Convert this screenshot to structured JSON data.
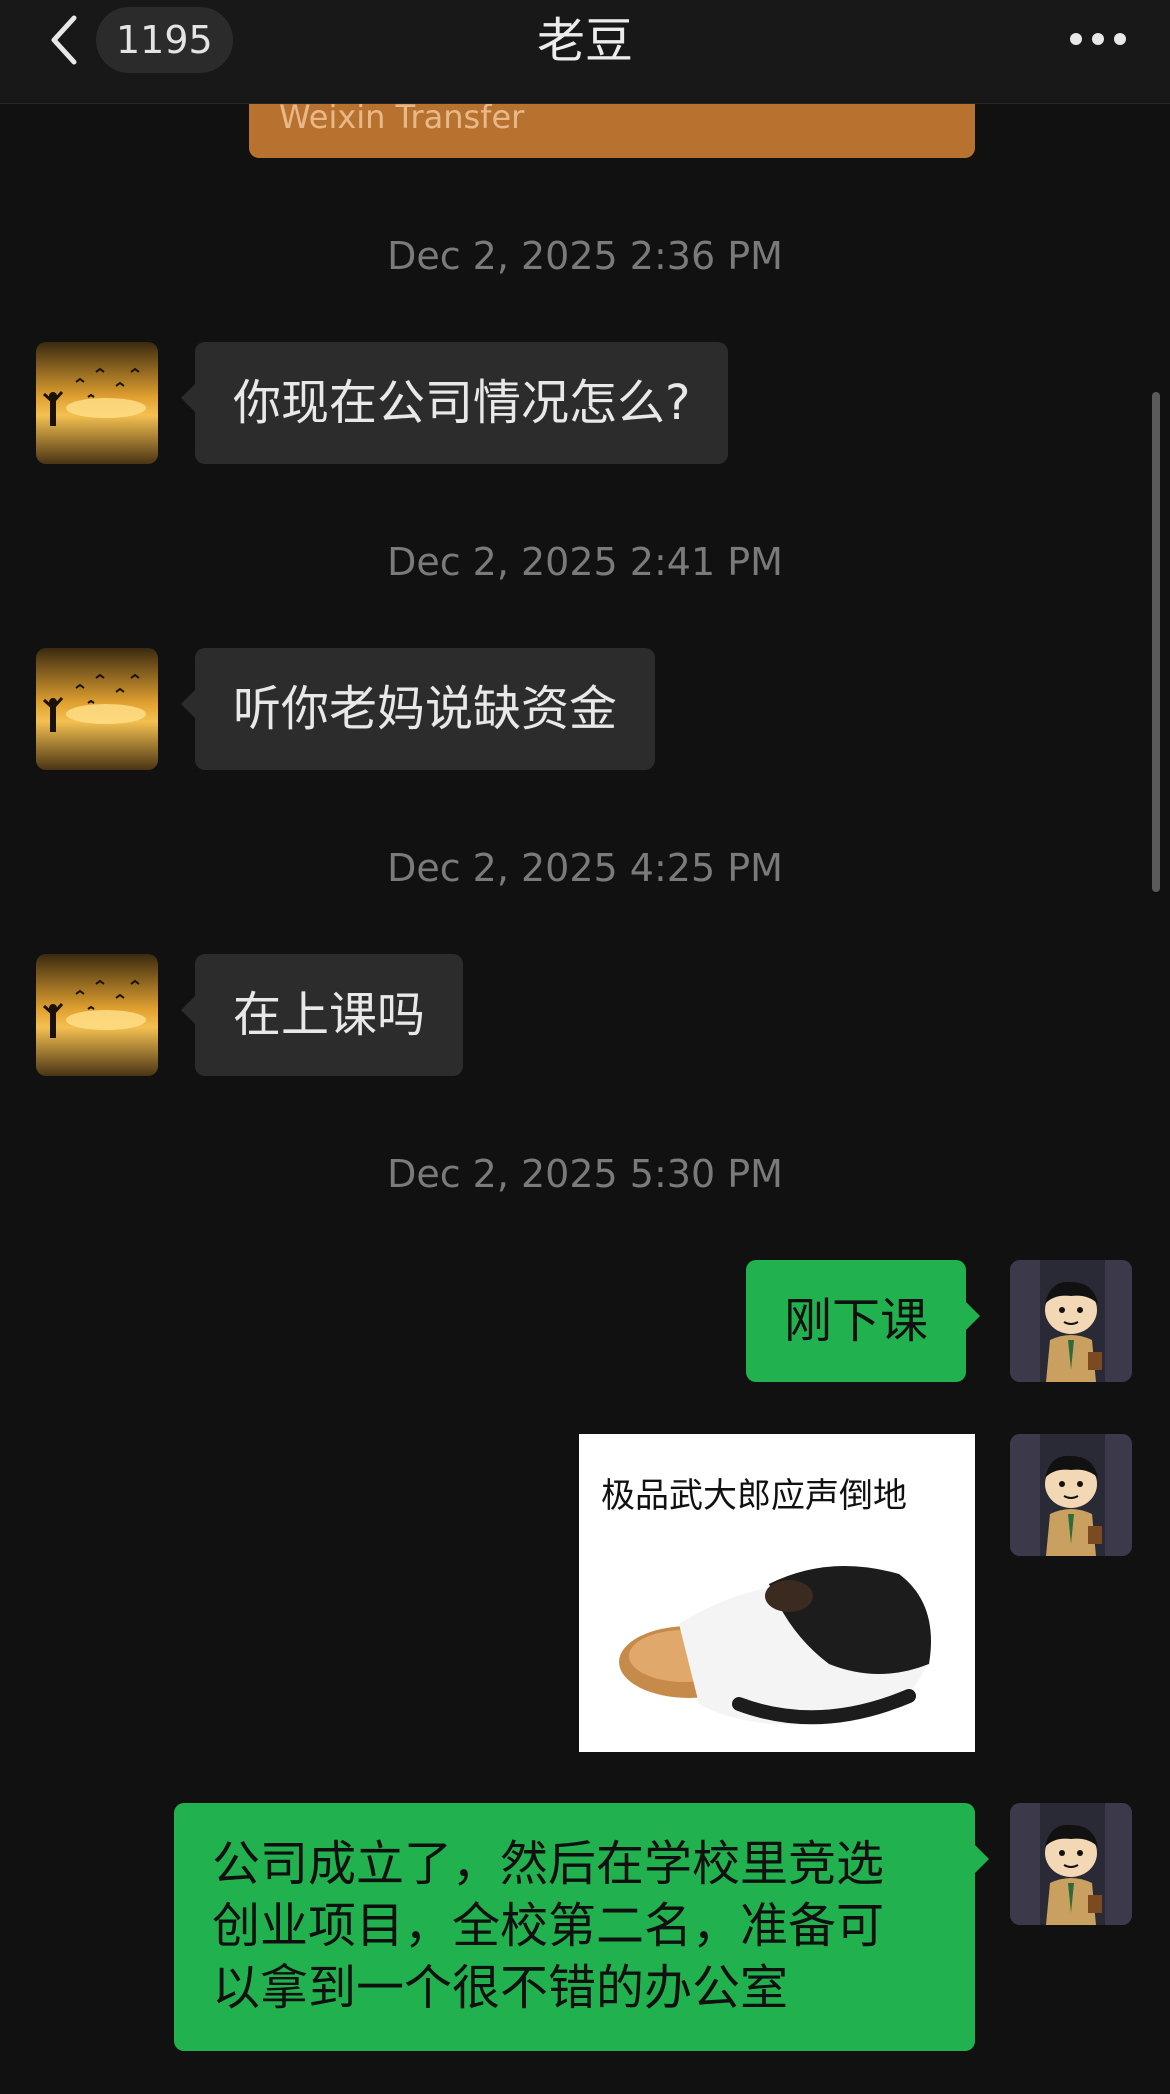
{
  "header": {
    "unread_count": "1195",
    "title": "老豆"
  },
  "transfer": {
    "label": "Weixin Transfer"
  },
  "messages": [
    {
      "timestamp": "Dec 2, 2025 2:36 PM",
      "sender": "contact",
      "text": "你现在公司情况怎么?"
    },
    {
      "timestamp": "Dec 2, 2025 2:41 PM",
      "sender": "contact",
      "text": "听你老妈说缺资金"
    },
    {
      "timestamp": "Dec 2, 2025 4:25 PM",
      "sender": "contact",
      "text": "在上课吗"
    },
    {
      "timestamp": "Dec 2, 2025 5:30 PM",
      "sender": "self",
      "text": "刚下课"
    },
    {
      "sender": "self",
      "type": "sticker",
      "caption": "极品武大郎应声倒地"
    },
    {
      "sender": "self",
      "lines": [
        "公司成立了，然后在学校里竞选",
        "创业项目，全校第二名，准备可",
        "以拿到一个很不错的办公室"
      ]
    }
  ],
  "colors": {
    "background": "#111111",
    "incoming_bubble": "#2c2c2c",
    "outgoing_bubble": "#22b14f",
    "transfer_card": "#b8722f"
  },
  "icons": {
    "back": "chevron-left-icon",
    "more": "more-dots-icon",
    "contact_avatar": "sunset-avatar",
    "self_avatar": "cartoon-boy-avatar"
  }
}
